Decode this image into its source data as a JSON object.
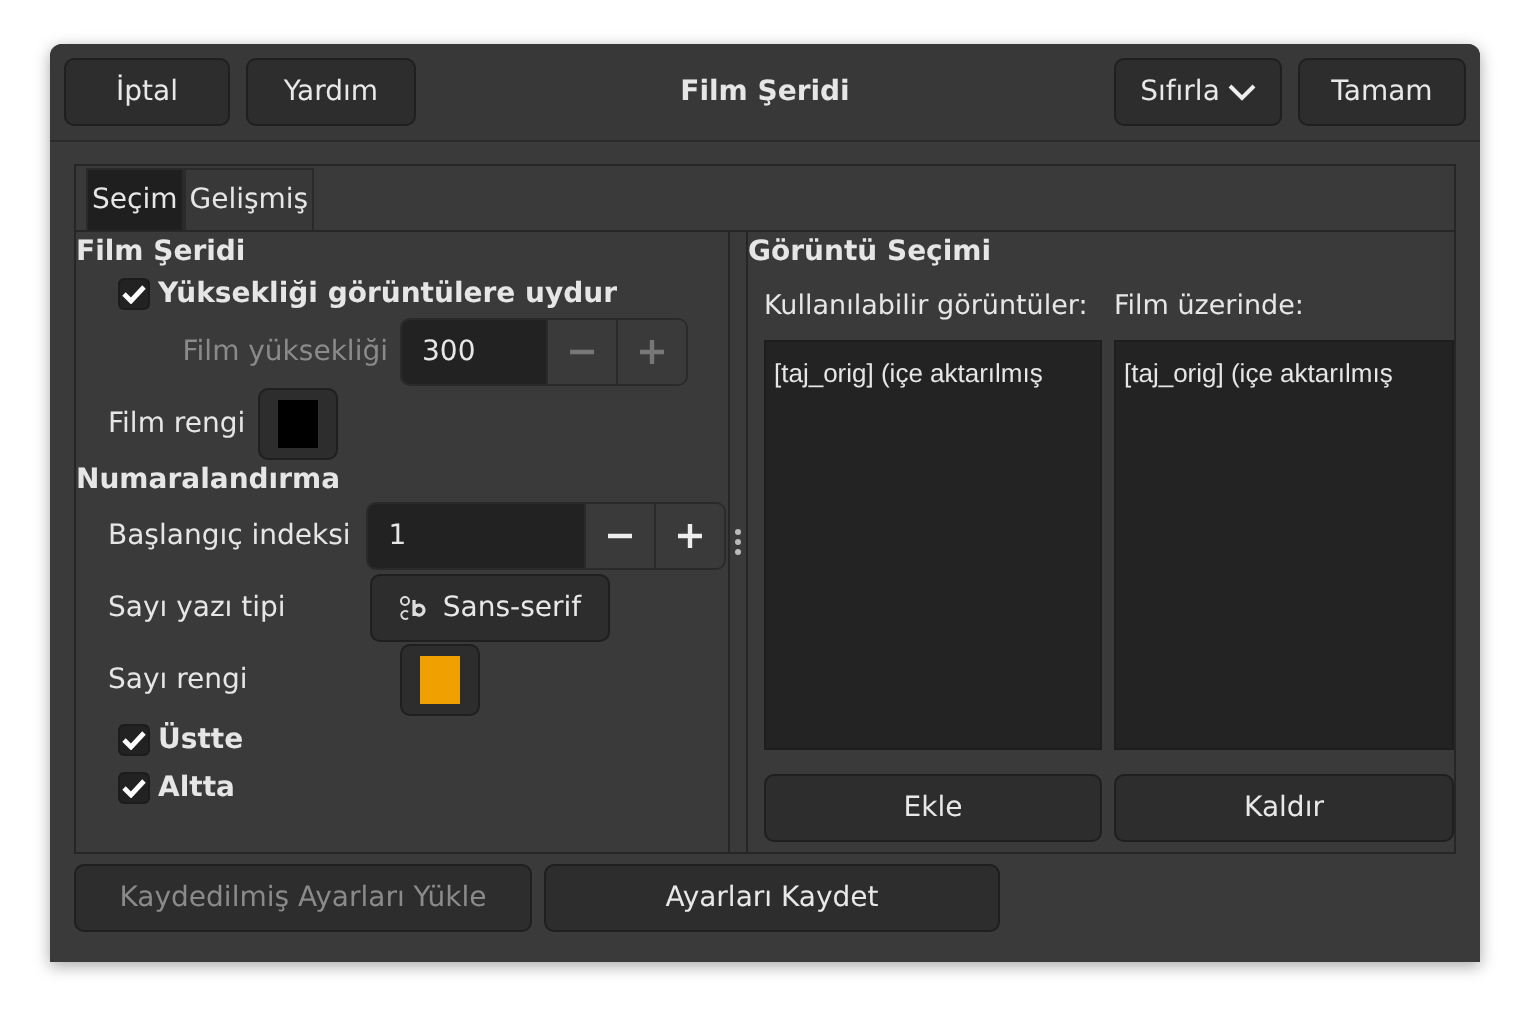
{
  "header": {
    "buttons": [
      {
        "label": "İptal"
      },
      {
        "label": "Yardım"
      }
    ],
    "title": "Film Şeridi",
    "reset": {
      "label": "Sıfırla"
    },
    "ok": {
      "label": "Tamam"
    }
  },
  "tabs": [
    {
      "label": "Seçim",
      "selected": true
    },
    {
      "label": "Gelişmiş",
      "selected": false
    }
  ],
  "film": {
    "heading": "Film Şeridi",
    "fit_height": {
      "label": "Yüksekliği görüntülere uydur",
      "checked": true
    },
    "height": {
      "label": "Film yüksekliği",
      "value": "300",
      "disabled": true
    },
    "color": {
      "label": "Film rengi",
      "color": "#000000"
    }
  },
  "numbering": {
    "heading": "Numaralandırma",
    "start": {
      "label": "Başlangıç indeksi",
      "value": "1",
      "disabled": false
    },
    "font": {
      "label": "Sayı yazı tipi",
      "value": "Sans-serif"
    },
    "color": {
      "label": "Sayı rengi",
      "color": "#f0a000"
    },
    "options": [
      {
        "label": "Üstte",
        "checked": true
      },
      {
        "label": "Altta",
        "checked": true
      }
    ]
  },
  "images": {
    "heading": "Görüntü Seçimi",
    "lists": [
      {
        "label": "Kullanılabilir görüntüler:",
        "items": [
          "[taj_orig] (içe aktarılmış"
        ],
        "button": "Ekle"
      },
      {
        "label": "Film üzerinde:",
        "items": [
          "[taj_orig] (içe aktarılmış"
        ],
        "button": "Kaldır"
      }
    ]
  },
  "footer": [
    {
      "label": "Kaydedilmiş Ayarları Yükle",
      "disabled": true
    },
    {
      "label": "Ayarları Kaydet",
      "disabled": false
    }
  ]
}
